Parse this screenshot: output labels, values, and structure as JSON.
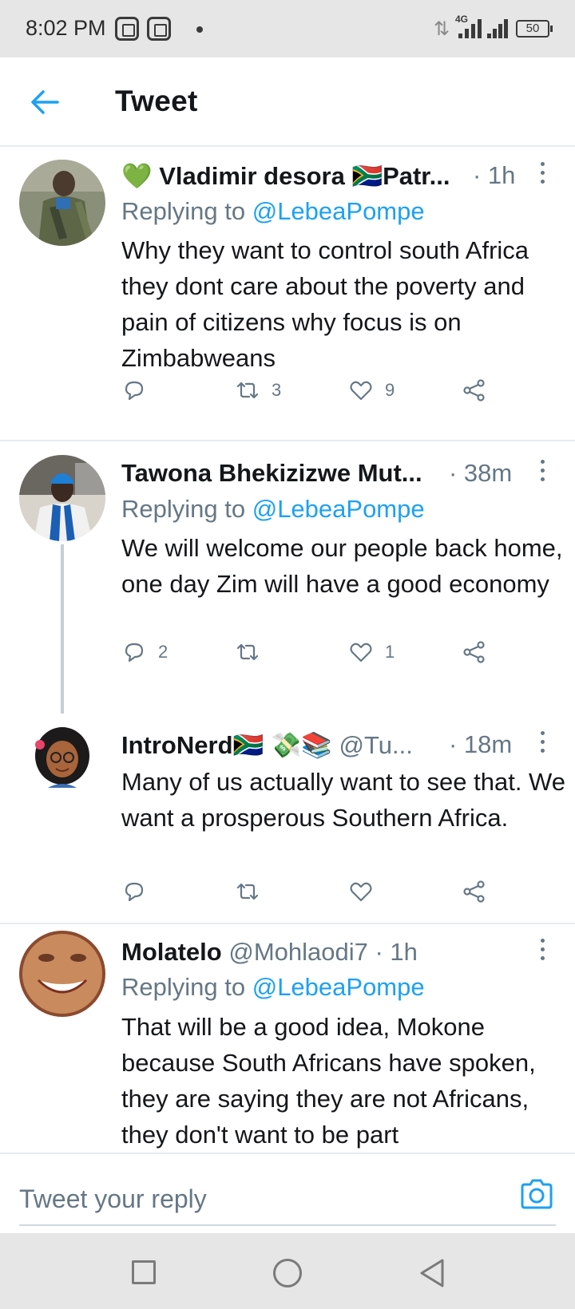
{
  "status_bar": {
    "time": "8:02 PM",
    "network": "4G",
    "battery": "50",
    "icons": [
      "app-notification-icon",
      "app-notification-icon",
      "data-arrows-icon",
      "signal-icon",
      "battery-icon"
    ]
  },
  "header": {
    "title": "Tweet",
    "back_icon": "back-arrow-icon"
  },
  "tweets": [
    {
      "emoji_prefix": "💚",
      "name": "Vladimir desora",
      "flag": "🇿🇦",
      "name_suffix": "Patr...",
      "handle": "",
      "time": "· 1h",
      "reply_label": "Replying to",
      "reply_mention": "@LebeaPompe",
      "text": "Why they want to control south Africa they dont care about the poverty and pain of citizens why focus is on Zimbabweans",
      "replies": "",
      "retweets": "3",
      "likes": "9"
    },
    {
      "name": "Tawona Bhekizizwe Mut...",
      "time": "· 38m",
      "reply_label": "Replying to",
      "reply_mention": "@LebeaPompe",
      "text": "We will welcome our people back home, one day Zim will have a good economy",
      "replies": "2",
      "retweets": "",
      "likes": "1"
    },
    {
      "name": "IntroNerd",
      "name_emojis": "🇿🇦 💸📚",
      "handle": "@Tu...",
      "time": "· 18m",
      "text": "Many of us actually want to see that. We want a prosperous Southern Africa.",
      "replies": "",
      "retweets": "",
      "likes": ""
    },
    {
      "name": "Molatelo",
      "handle": "@Mohlaodi7",
      "time": "· 1h",
      "reply_label": "Replying to",
      "reply_mention": "@LebeaPompe",
      "text": "That will be a good idea, Mokone because South Africans have spoken, they are saying they are not Africans, they don't want to be part"
    }
  ],
  "reply_bar": {
    "placeholder": "Tweet your reply",
    "camera_icon": "camera-icon"
  },
  "nav_bar": {
    "icons": [
      "recents-square-icon",
      "home-circle-icon",
      "back-triangle-icon"
    ]
  },
  "colors": {
    "accent": "#1da1f2",
    "secondary_text": "#657786",
    "primary_text": "#14171a",
    "divider": "#e6ecf0",
    "system_bar": "#e6e6e6"
  }
}
